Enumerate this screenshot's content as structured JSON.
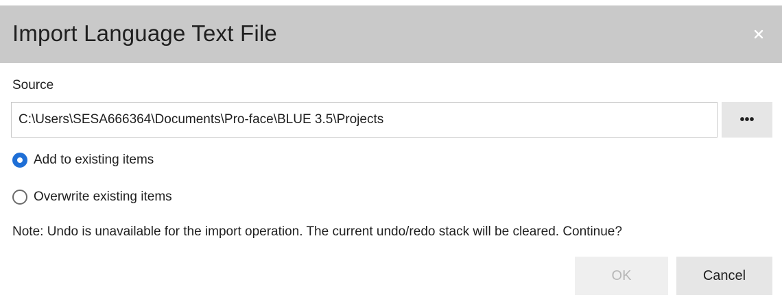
{
  "dialog": {
    "title": "Import Language Text File",
    "close_icon": "close-icon"
  },
  "source": {
    "label": "Source",
    "path_value": "C:\\Users\\SESA666364\\Documents\\Pro-face\\BLUE 3.5\\Projects",
    "browse_label": "•••"
  },
  "options": {
    "add_label": "Add to existing items",
    "add_checked": true,
    "overwrite_label": "Overwrite existing items",
    "overwrite_checked": false
  },
  "note": "Note: Undo is unavailable for the import operation. The current undo/redo stack will be cleared. Continue?",
  "buttons": {
    "ok_label": "OK",
    "ok_enabled": false,
    "cancel_label": "Cancel"
  },
  "colors": {
    "titlebar": "#c9c9c9",
    "accent": "#1f6fd6",
    "button_bg": "#e6e6e6",
    "disabled_text": "#b7b7b7"
  }
}
